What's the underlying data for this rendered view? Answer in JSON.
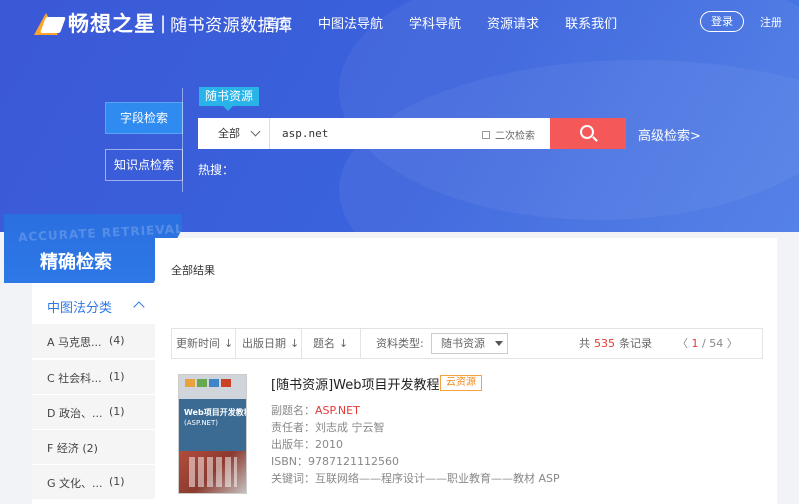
{
  "header": {
    "brand_name": "畅想之星",
    "brand_sep": "|",
    "brand_sub": "随书资源数据库",
    "nav": [
      "首页",
      "中图法导航",
      "学科导航",
      "资源请求",
      "联系我们"
    ],
    "login": "登录",
    "register": "注册"
  },
  "search": {
    "tabs": [
      "字段检索",
      "知识点检索"
    ],
    "resource_tag": "随书资源",
    "scope": "全部",
    "query": "asp.net",
    "second_search": "二次检索",
    "advanced": "高级检索>",
    "hot_label": "热搜："
  },
  "sidebar": {
    "watermark": "ACCURATE RETRIEVAL",
    "title": "精确检索",
    "section": "中图法分类",
    "items": [
      {
        "name": "A 马克思...",
        "count": "(4)"
      },
      {
        "name": "C 社会科...",
        "count": "(1)"
      },
      {
        "name": "D 政治、...",
        "count": "(1)"
      },
      {
        "name": "F 经济 (2)",
        "count": ""
      },
      {
        "name": "G 文化、...",
        "count": "(1)"
      }
    ]
  },
  "results": {
    "all_label": "全部结果",
    "sort": [
      "更新时间",
      "出版日期",
      "题名"
    ],
    "sort_arrow": "↓",
    "type_label": "资料类型:",
    "type_value": "随书资源",
    "total_prefix": "共",
    "total": "535",
    "total_suffix": "条记录",
    "pager_prev": "〈",
    "page": "1",
    "pager_sep": "/",
    "pages": "54",
    "pager_next": "〉",
    "items": [
      {
        "title": "[随书资源]Web项目开发教程",
        "badge": "云资源",
        "cover_title": "Web项目开发教程",
        "cover_sub": "(ASP.NET)",
        "fields": [
          {
            "label": "副题名：",
            "value": "ASP.NET",
            "highlight": true
          },
          {
            "label": "责任者：",
            "value": "刘志成 宁云智"
          },
          {
            "label": "出版年：",
            "value": "2010"
          },
          {
            "label": "ISBN：",
            "value": "9787121112560"
          },
          {
            "label": "关键词：",
            "value": "互联网络——程序设计——职业教育——教材 ASP"
          }
        ]
      }
    ]
  },
  "colors": {
    "hero": "#3a63dd",
    "accent": "#2e78e6",
    "search_button": "#f45858",
    "highlight": "#e53935",
    "badge": "#f08b1d"
  }
}
